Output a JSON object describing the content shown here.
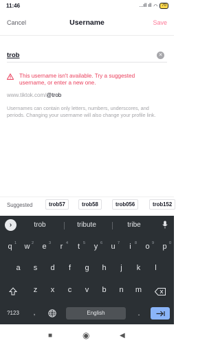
{
  "status": {
    "time": "11:46",
    "signal": "...ıll ıll",
    "battery": "70"
  },
  "header": {
    "cancel": "Cancel",
    "title": "Username",
    "save": "Save"
  },
  "field": {
    "value": "trob"
  },
  "error": {
    "text": "This username isn't available. Try a suggested username, or enter a new one."
  },
  "url": {
    "prefix": "www.tiktok.com/",
    "handle": "@trob"
  },
  "help": "Usernames can contain only letters, numbers, underscores, and periods. Changing your username will also change your profile link.",
  "suggestions": {
    "label": "Suggested",
    "chips": [
      "trob57",
      "trob58",
      "trob056",
      "trob152"
    ]
  },
  "keyboard": {
    "predictions": [
      "trob",
      "tribute",
      "tribe"
    ],
    "row1": [
      [
        "q",
        "1"
      ],
      [
        "w",
        "2"
      ],
      [
        "e",
        "3"
      ],
      [
        "r",
        "4"
      ],
      [
        "t",
        "5"
      ],
      [
        "y",
        "6"
      ],
      [
        "u",
        "7"
      ],
      [
        "i",
        "8"
      ],
      [
        "o",
        "9"
      ],
      [
        "p",
        "0"
      ]
    ],
    "row2": [
      "a",
      "s",
      "d",
      "f",
      "g",
      "h",
      "j",
      "k",
      "l"
    ],
    "row3": [
      "z",
      "x",
      "c",
      "v",
      "b",
      "n",
      "m"
    ],
    "symbols": "?123",
    "comma": ",",
    "period": ".",
    "space": "English",
    "shift_icon": "shift-icon",
    "backspace_icon": "backspace-icon",
    "enter_icon": "enter-arrow-icon"
  },
  "colors": {
    "accent": "#fe2c55",
    "error": "#ea3f5c",
    "keyboard_bg": "#2b3034",
    "enter_key": "#8ab4f8"
  }
}
